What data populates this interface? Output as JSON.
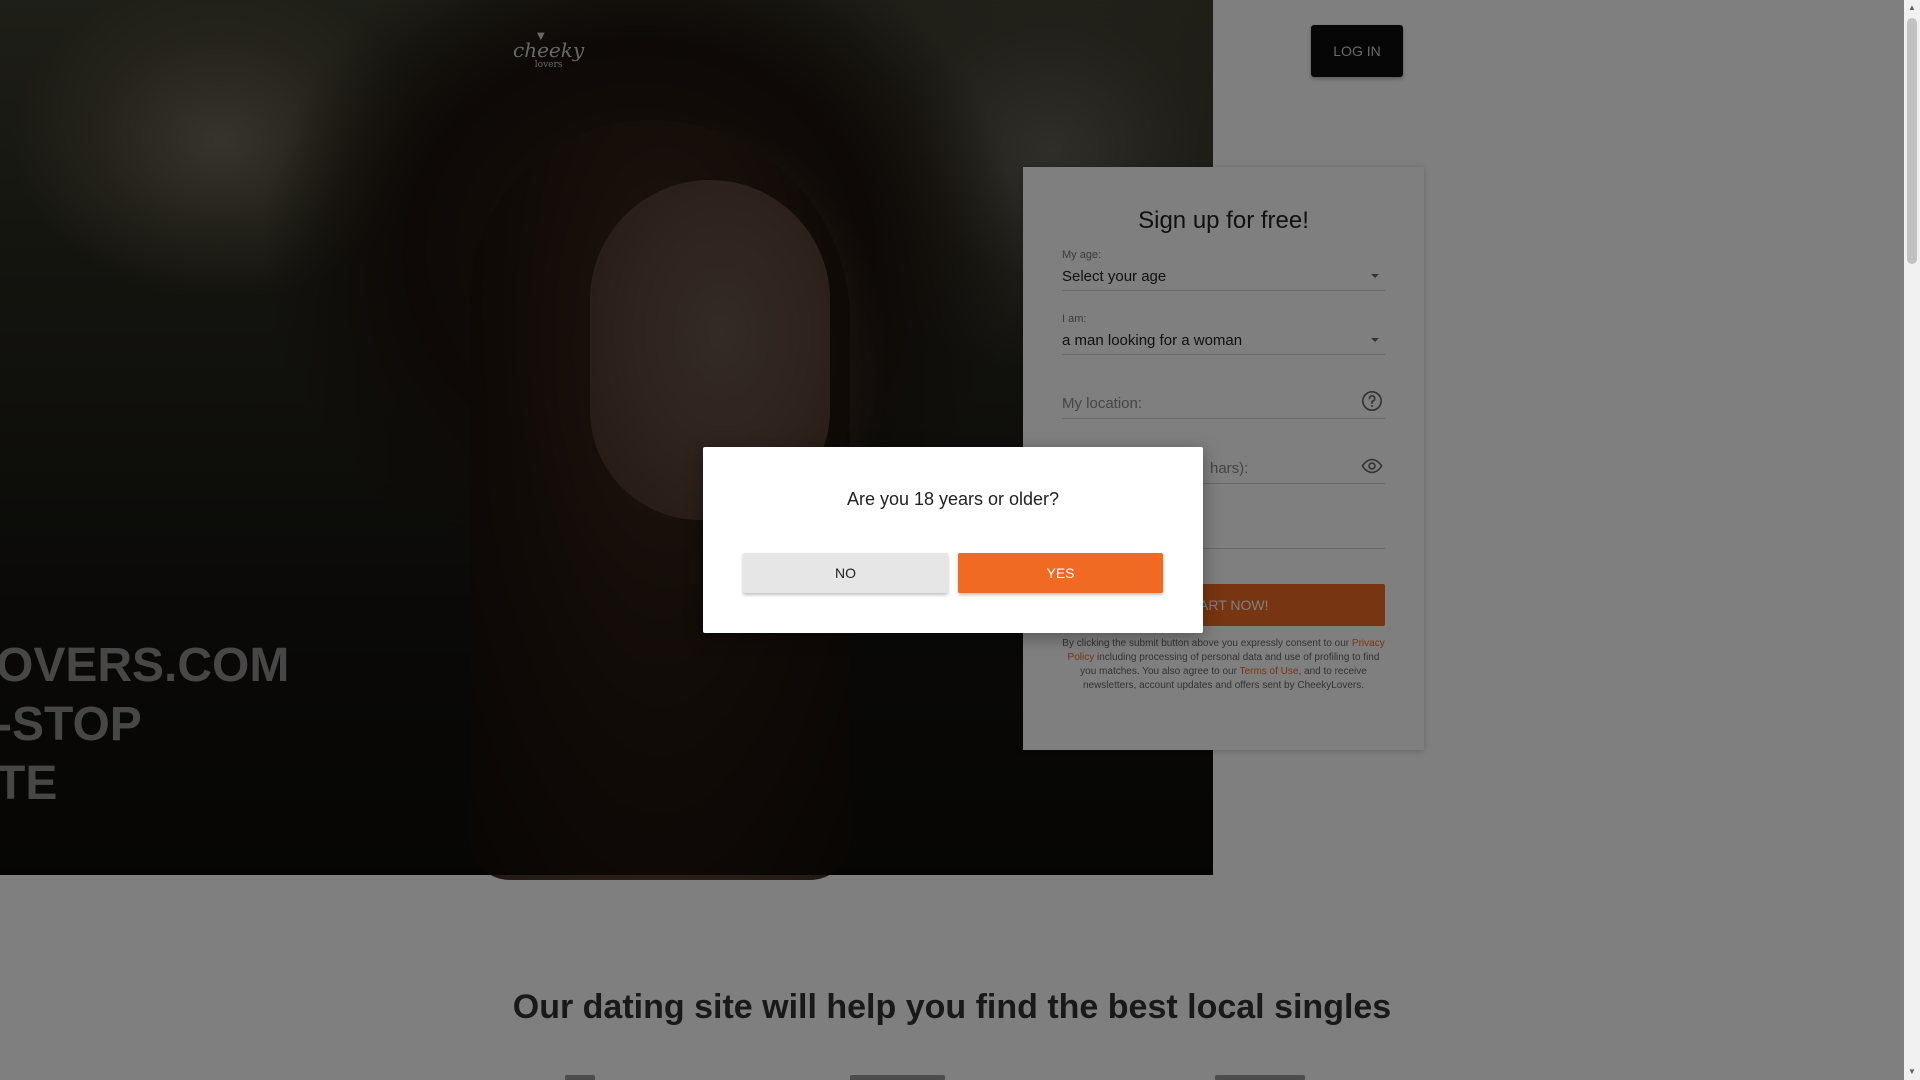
{
  "header": {
    "logo_text": "cheeky",
    "logo_sub": "lovers",
    "login_label": "LOG IN"
  },
  "hero": {
    "headline_lines": [
      "OVERS.COM",
      "-STOP",
      "TE"
    ]
  },
  "signup": {
    "title": "Sign up for free!",
    "age_label": "My age:",
    "age_value": "Select your age",
    "iam_label": "I am:",
    "iam_value": "a man looking for a woman",
    "location_placeholder": "My location:",
    "password_placeholder_visible": "hars):",
    "submit_label_visible": "ART NOW!",
    "legal": {
      "part1": "By clicking the submit button above you expressly consent to our",
      "privacy_link": "Privacy Policy",
      "part2": "including processing of personal data and use of profiling to find you matches. You also agree to our",
      "terms_link": "Terms of Use",
      "part3": ", and to receive newsletters, account updates and offers sent by CheekyLovers."
    }
  },
  "bottom": {
    "heading": "Our dating site will help you find the best local singles"
  },
  "modal": {
    "question": "Are you 18 years or older?",
    "no_label": "NO",
    "yes_label": "YES"
  },
  "colors": {
    "accent": "#f06a24",
    "login_bg": "#0d0d0d"
  },
  "icons": {
    "location_help": "help-circle-icon",
    "password_toggle": "eye-icon",
    "age_dropdown": "chevron-down-icon",
    "gender_dropdown": "chevron-down-icon"
  }
}
